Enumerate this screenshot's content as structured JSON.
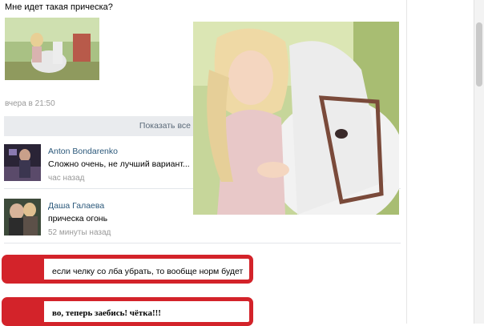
{
  "post": {
    "title": "Мне идет такая прическа?",
    "time": "вчера в 21:50",
    "show_all_label": "Показать все"
  },
  "comments": [
    {
      "author": "Anton Bondarenko",
      "text": "Сложно очень, не лучший вариант...",
      "time": "час назад"
    },
    {
      "author": "Даша Галаева",
      "text": "прическа огонь",
      "time": "52 минуты назад"
    }
  ],
  "highlights": [
    {
      "text": "если челку со лба убрать, то вообще норм будет"
    },
    {
      "text": "во, теперь заебись! чётка!!!"
    }
  ],
  "colors": {
    "link": "#2b587a",
    "muted": "#999999",
    "panel": "#e9ebee",
    "highlight_red": "#d3232a"
  }
}
